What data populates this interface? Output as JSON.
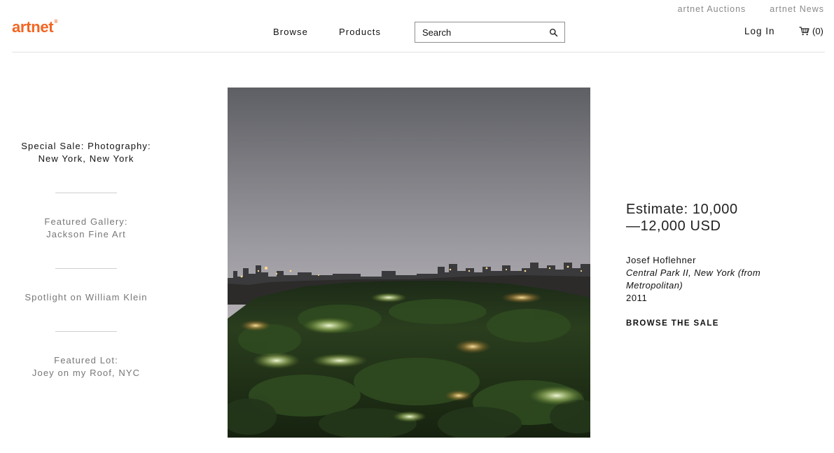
{
  "header": {
    "logo_text": "artnet",
    "logo_mark": "®",
    "top_links": [
      "artnet Auctions",
      "artnet News"
    ],
    "nav": {
      "browse": "Browse",
      "products": "Products"
    },
    "search": {
      "placeholder": "Search",
      "icon": "search-icon"
    },
    "login": "Log In",
    "cart": {
      "icon": "cart-icon",
      "count_label": "(0)"
    },
    "brand_color": "#f26522"
  },
  "sidebar": {
    "special_sale": {
      "line1": "Special Sale: Photography:",
      "line2": "New York, New York"
    },
    "featured_gallery": {
      "line1": "Featured Gallery:",
      "line2": "Jackson Fine Art"
    },
    "spotlight": "Spotlight on William Klein",
    "featured_lot": {
      "line1": "Featured Lot:",
      "line2": "Joey on my Roof, NYC"
    }
  },
  "feature": {
    "estimate_line1": "Estimate: 10,000",
    "estimate_line2": "—12,000 USD",
    "artist": "Josef Hoflehner",
    "title_line1": "Central Park II, New York (from",
    "title_line2": "Metropolitan)",
    "year": "2011",
    "cta": "BROWSE THE SALE"
  }
}
